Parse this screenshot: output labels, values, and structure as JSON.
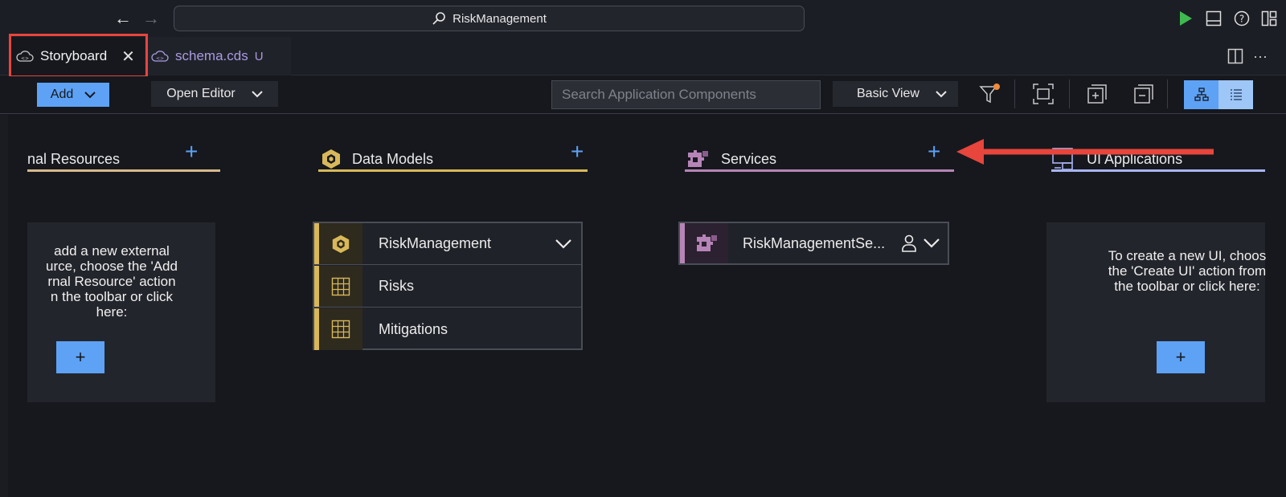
{
  "titlebar": {
    "back_icon": "arrow-left-icon",
    "forward_icon": "arrow-right-icon",
    "command_center_text": "RiskManagement",
    "colors": {
      "run": "#3fb950"
    }
  },
  "tabs": [
    {
      "label": "Storyboard",
      "icon": "cloud-code-icon",
      "active": true
    },
    {
      "label": "schema.cds",
      "icon": "cloud-code-icon",
      "badge": "U",
      "active": false
    }
  ],
  "toolbar": {
    "add_label": "Add",
    "open_editor_label": "Open Editor",
    "search_placeholder": "Search Application Components",
    "view_label": "Basic View",
    "colors": {
      "primary": "#5da2f5",
      "filter_dot": "#f08a3c"
    }
  },
  "columns": {
    "external_resources": {
      "title": "nal Resources",
      "color": "#d7b98a",
      "empty_text": [
        "add a new external",
        "urce, choose the 'Add",
        "rnal Resource' action",
        "n the toolbar or click",
        "here:"
      ]
    },
    "data_models": {
      "title": "Data Models",
      "color": "#d9b85a",
      "items": [
        {
          "label": "RiskManagement",
          "icon": "cube-icon"
        },
        {
          "label": "Risks",
          "icon": "table-icon"
        },
        {
          "label": "Mitigations",
          "icon": "table-icon"
        }
      ]
    },
    "services": {
      "title": "Services",
      "color": "#b684b7",
      "items": [
        {
          "label": "RiskManagementSe...",
          "icon": "puzzle-icon"
        }
      ]
    },
    "ui_applications": {
      "title": "UI Applications",
      "color": "#a8b4f0",
      "empty_text": [
        "To create a new UI, choos",
        "the 'Create UI' action from",
        "the toolbar or click here:"
      ]
    }
  },
  "annotation": {
    "arrow_color": "#e8453c",
    "box_color": "#e8453c"
  }
}
